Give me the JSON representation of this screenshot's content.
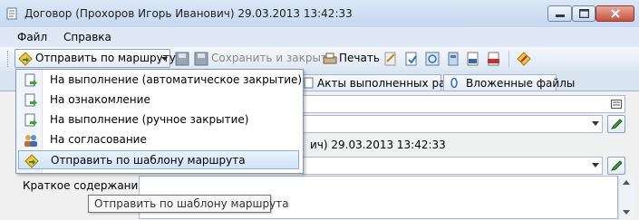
{
  "window": {
    "title": "Договор (Прохоров Игорь Иванович) 29.03.2013 13:42:33"
  },
  "menu": {
    "items": [
      "Файл",
      "Справка"
    ]
  },
  "toolbar": {
    "send_route": "Отправить по маршруту",
    "save_close": "Сохранить и закрыть",
    "print": "Печать"
  },
  "tabs": [
    "Акты выполненных работ",
    "Вложенные файлы"
  ],
  "form": {
    "author_partial": "ич) 29.03.2013 13:42:33",
    "summary_label": "Краткое содержание:"
  },
  "dropdown": {
    "items": [
      {
        "label": "На выполнение (автоматическое закрытие)",
        "icon": "doc-arrow-icon"
      },
      {
        "label": "На ознакомление",
        "icon": "doc-arrow-icon"
      },
      {
        "label": "На выполнение (ручное закрытие)",
        "icon": "doc-arrow-icon"
      },
      {
        "label": "На согласование",
        "icon": "people-icon"
      },
      {
        "label": "Отправить по шаблону маршрута",
        "icon": "route-template-icon"
      }
    ],
    "selected_index": 4
  },
  "tooltip": {
    "text": "Отправить по шаблону маршрута"
  },
  "colors": {
    "titlebar": "#c6d8ef",
    "highlight": "#cfe3f7",
    "close_button": "#c7503d"
  }
}
